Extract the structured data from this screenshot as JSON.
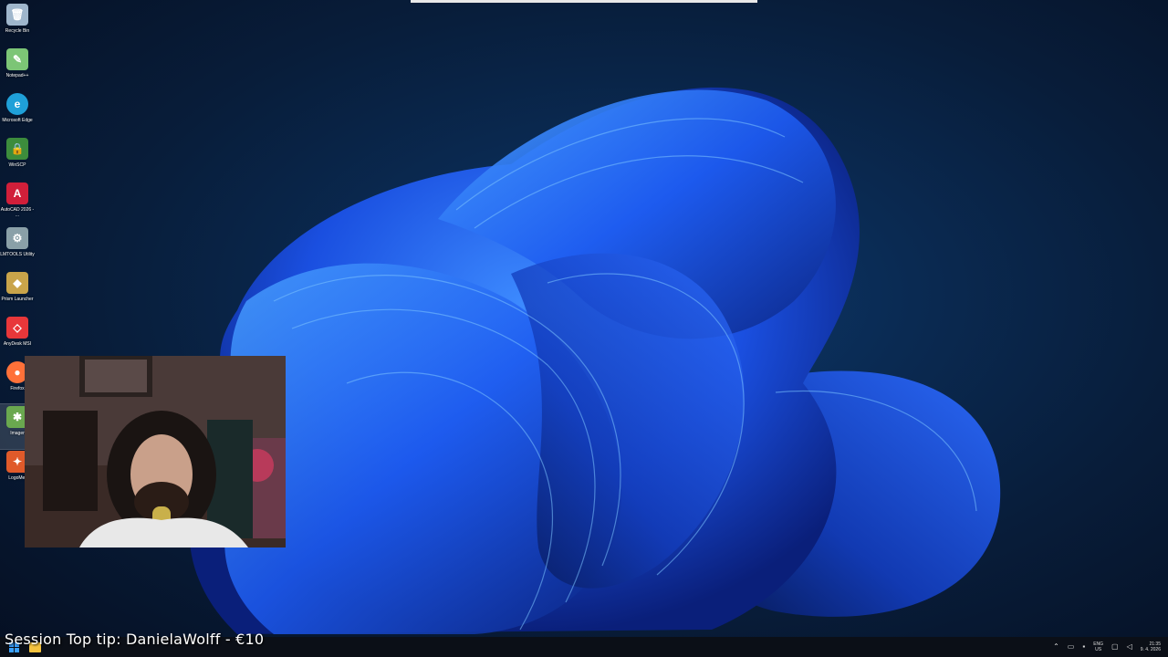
{
  "desktop": {
    "icons": [
      {
        "label": "Recycle Bin",
        "icon": "recycle-bin-icon",
        "color": "#9fb6cc"
      },
      {
        "label": "Notepad++",
        "icon": "notepad-plus-plus-icon",
        "color": "#7cc576"
      },
      {
        "label": "Microsoft Edge",
        "icon": "edge-icon",
        "color": "#1fa0d8"
      },
      {
        "label": "WinSCP",
        "icon": "winscp-icon",
        "color": "#3c8c3c"
      },
      {
        "label": "AutoCAD 2026 - ...",
        "icon": "autocad-icon",
        "color": "#d11f3a",
        "glyph": "A"
      },
      {
        "label": "LMTOOLS Utility",
        "icon": "lmtools-icon",
        "color": "#8aa0a8"
      },
      {
        "label": "Prism Launcher",
        "icon": "prism-launcher-icon",
        "color": "#c9a44a"
      },
      {
        "label": "AnyDesk MSI",
        "icon": "anydesk-icon",
        "color": "#e8373a"
      },
      {
        "label": "Firefox",
        "icon": "firefox-icon",
        "color": "#ff7139"
      },
      {
        "label": "Imager",
        "icon": "imager-icon",
        "color": "#6aa84f"
      },
      {
        "label": "LogoMet",
        "icon": "logomet-icon",
        "color": "#e05a2a"
      }
    ]
  },
  "overlay": {
    "tip": "Session Top tip: DanielaWolff - €10"
  },
  "taskbar": {
    "lang_line1": "ENG",
    "lang_line2": "US",
    "time": "21:35",
    "date": "9. 4. 2026"
  }
}
